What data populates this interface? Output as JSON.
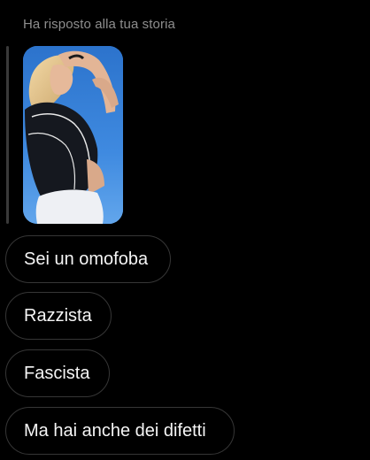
{
  "conversation": {
    "reply_label": "Ha risposto alla tua storia",
    "messages": [
      {
        "text": "Sei un omofoba"
      },
      {
        "text": "Razzista"
      },
      {
        "text": "Fascista"
      },
      {
        "text": "Ma hai anche dei difetti"
      }
    ]
  },
  "colors": {
    "background": "#000000",
    "muted_text": "#8e8e8e",
    "bubble_border": "#363636",
    "bubble_text": "#f5f5f5",
    "story_sky": "#3f8ae0"
  },
  "icons": {
    "story_preview": "photo-thumbnail"
  }
}
